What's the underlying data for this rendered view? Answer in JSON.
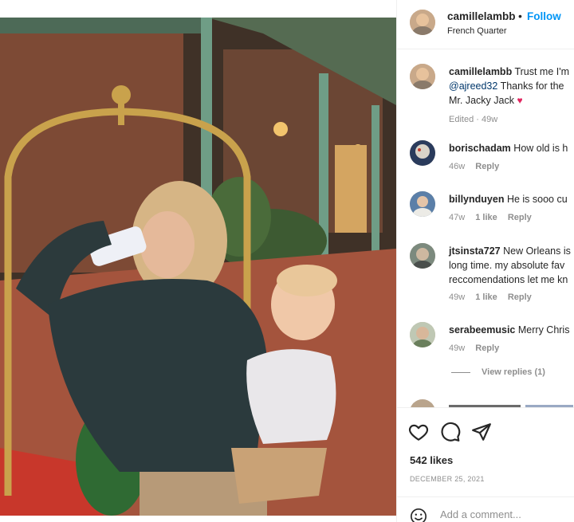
{
  "post": {
    "username": "camillelambb",
    "follow_label": "Follow",
    "dot": "•",
    "location": "French Quarter"
  },
  "comments": [
    {
      "username": "camillelambb",
      "line1": "Trust me I'm",
      "mention": "@ajreed32",
      "line2": "Thanks for the",
      "line3": "Mr. Jacky Jack",
      "emoji": "♥",
      "time": "Edited · 49w"
    },
    {
      "username": "borischadam",
      "text": "How old is h",
      "time": "46w",
      "reply": "Reply"
    },
    {
      "username": "billynduyen",
      "text": "He is sooo cu",
      "time": "47w",
      "likes": "1 like",
      "reply": "Reply"
    },
    {
      "username": "jtsinsta727",
      "line1": "New Orleans is",
      "line2": "long time. my absolute fav",
      "line3": "reccomendations let me kn",
      "time": "49w",
      "likes": "1 like",
      "reply": "Reply"
    },
    {
      "username": "serabeemusic",
      "text": "Merry Chris",
      "time": "49w",
      "reply": "Reply"
    }
  ],
  "view_replies": "View replies (1)",
  "icons": {
    "like": "heart-icon",
    "comment": "comment-icon",
    "share": "share-icon",
    "emoji": "emoji-icon"
  },
  "stats": {
    "likes": "542 likes",
    "date": "DECEMBER 25, 2021"
  },
  "comment_box": {
    "placeholder": "Add a comment..."
  },
  "colors": {
    "follow": "#0095f6",
    "heart": "#e0245e",
    "muted": "#8e8e8e"
  }
}
